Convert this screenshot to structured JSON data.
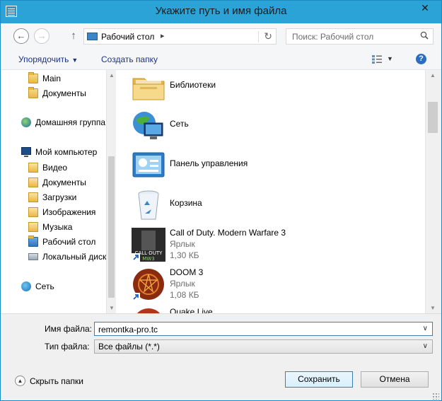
{
  "window": {
    "title": "Укажите путь и имя файла",
    "close": "✕"
  },
  "address": {
    "crumb": "Рабочий стол",
    "crumb_arrow": "▸",
    "dropdown": "▾",
    "refresh": "↻"
  },
  "search": {
    "placeholder": "Поиск: Рабочий стол"
  },
  "nav_buttons": {
    "back": "←",
    "forward": "→",
    "up": "↑"
  },
  "toolbar": {
    "organize": "Упорядочить",
    "organize_arrow": "▼",
    "new_folder": "Создать папку",
    "view_dd": "▼",
    "help": "?"
  },
  "nav_pane": [
    {
      "label": "Main",
      "icon": "folder-icon"
    },
    {
      "label": "Документы",
      "icon": "folder-icon"
    },
    {
      "label": "Домашняя группа",
      "icon": "homegroup-icon"
    },
    {
      "label": "Мой компьютер",
      "icon": "computer-icon"
    },
    {
      "label": "Видео",
      "icon": "library-icon"
    },
    {
      "label": "Документы",
      "icon": "library-icon"
    },
    {
      "label": "Загрузки",
      "icon": "library-icon"
    },
    {
      "label": "Изображения",
      "icon": "library-icon"
    },
    {
      "label": "Музыка",
      "icon": "library-icon"
    },
    {
      "label": "Рабочий стол",
      "icon": "folder-icon"
    },
    {
      "label": "Локальный диск",
      "icon": "drive-icon"
    },
    {
      "label": "Сеть",
      "icon": "network-icon"
    }
  ],
  "files": [
    {
      "name": "Библиотеки",
      "icon": "libraries-icon"
    },
    {
      "name": "Сеть",
      "icon": "network-icon"
    },
    {
      "name": "Панель управления",
      "icon": "control-panel-icon"
    },
    {
      "name": "Корзина",
      "icon": "recycle-bin-icon"
    },
    {
      "name": "Call of Duty. Modern Warfare 3",
      "type": "Ярлык",
      "size": "1,30 КБ",
      "icon": "cod-shortcut-icon"
    },
    {
      "name": "DOOM 3",
      "type": "Ярлык",
      "size": "1,08 КБ",
      "icon": "doom-shortcut-icon"
    },
    {
      "name": "Quake Live",
      "icon": "quake-shortcut-icon"
    }
  ],
  "form": {
    "filename_label": "Имя файла:",
    "filename_value": "remontka-pro.tc",
    "filetype_label": "Тип файла:",
    "filetype_value": "Все файлы (*.*)",
    "chevron": "∨"
  },
  "footer": {
    "hide_folders": "Скрыть папки",
    "hide_arrow": "▲",
    "save": "Сохранить",
    "cancel": "Отмена"
  },
  "scroll": {
    "up": "▲",
    "down": "▼"
  },
  "colors": {
    "titlebar": "#2ba3d6",
    "link": "#1e3287",
    "accent": "#3c7fb1"
  }
}
